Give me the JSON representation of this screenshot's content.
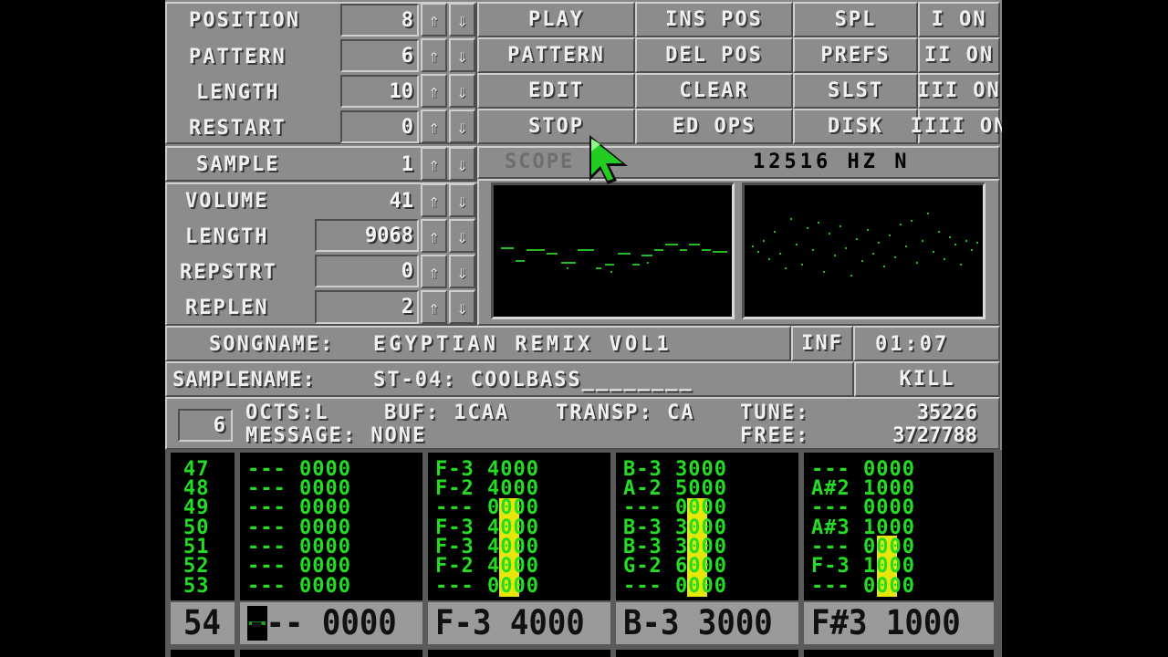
{
  "song_controls": {
    "position": {
      "label": "POSITION",
      "value": "8"
    },
    "pattern": {
      "label": "PATTERN",
      "value": "6"
    },
    "length": {
      "label": "LENGTH",
      "value": "10"
    },
    "restart": {
      "label": "RESTART",
      "value": "0"
    }
  },
  "arrows": {
    "up": "⇑",
    "down": "⇓"
  },
  "buttons": {
    "play": "PLAY",
    "pattern": "PATTERN",
    "edit": "EDIT",
    "stop": "STOP",
    "ins_pos": "INS POS",
    "del_pos": "DEL POS",
    "clear": "CLEAR",
    "ed_ops": "ED OPS",
    "spl": "SPL",
    "prefs": "PREFS",
    "slst": "SLST",
    "disk": "DISK",
    "kill": "KILL"
  },
  "channels": [
    {
      "label": "I ON"
    },
    {
      "label": "II ON"
    },
    {
      "label": "III ON"
    },
    {
      "label": "IIII ON"
    }
  ],
  "sample": {
    "label": "SAMPLE",
    "value": "1"
  },
  "sample_params": {
    "volume": {
      "label": "VOLUME",
      "value": "41"
    },
    "length": {
      "label": "LENGTH",
      "value": "9068"
    },
    "repstrt": {
      "label": "REPSTRT",
      "value": "0"
    },
    "replen": {
      "label": "REPLEN",
      "value": "2"
    }
  },
  "scope": {
    "label": "SCOPE",
    "freq": "12516 HZ N"
  },
  "songname": {
    "label": "SONGNAME:",
    "value": "EGYPTIAN REMIX VOL1"
  },
  "inf": "INF",
  "time": "01:07",
  "samplename": {
    "label": "SAMPLENAME:",
    "value": "ST-04: COOLBASS________"
  },
  "info": {
    "number": "6",
    "octs": "OCTS:L",
    "buf": "BUF: 1CAA",
    "transp": "TRANSP: CA",
    "tune_label": "TUNE:",
    "tune_value": "35226",
    "message": "MESSAGE: NONE",
    "free_label": "FREE:",
    "free_value": "3727788"
  },
  "pattern_editor": {
    "rows": [
      "47",
      "48",
      "49",
      "50",
      "51",
      "52",
      "53"
    ],
    "tracks": [
      [
        "--- 0000",
        "--- 0000",
        "--- 0000",
        "--- 0000",
        "--- 0000",
        "--- 0000",
        "--- 0000"
      ],
      [
        "F-3 4000",
        "F-2 4000",
        "--- 0000",
        "F-3 4000",
        "F-3 4000",
        "F-2 4000",
        "--- 0000"
      ],
      [
        "B-3 3000",
        "A-2 5000",
        "--- 0000",
        "B-3 3000",
        "B-3 3000",
        "G-2 6000",
        "--- 0000"
      ],
      [
        "--- 0000",
        "A#2 1000",
        "--- 0000",
        "A#3 1000",
        "--- 0000",
        "F-3 1000",
        "--- 0000"
      ]
    ],
    "vu_levels": [
      0.0,
      0.52,
      0.52,
      0.32
    ],
    "current": {
      "row": "54",
      "cells": [
        "--- 0000",
        "F-3 4000",
        "B-3 3000",
        "F#3 1000"
      ]
    }
  },
  "colors": {
    "panel": "#888888",
    "text_green": "#22dd22",
    "vu": "#e6e60a",
    "cursor": "#1a9f1a"
  },
  "pointer_icon": "green-arrow-cursor-icon"
}
